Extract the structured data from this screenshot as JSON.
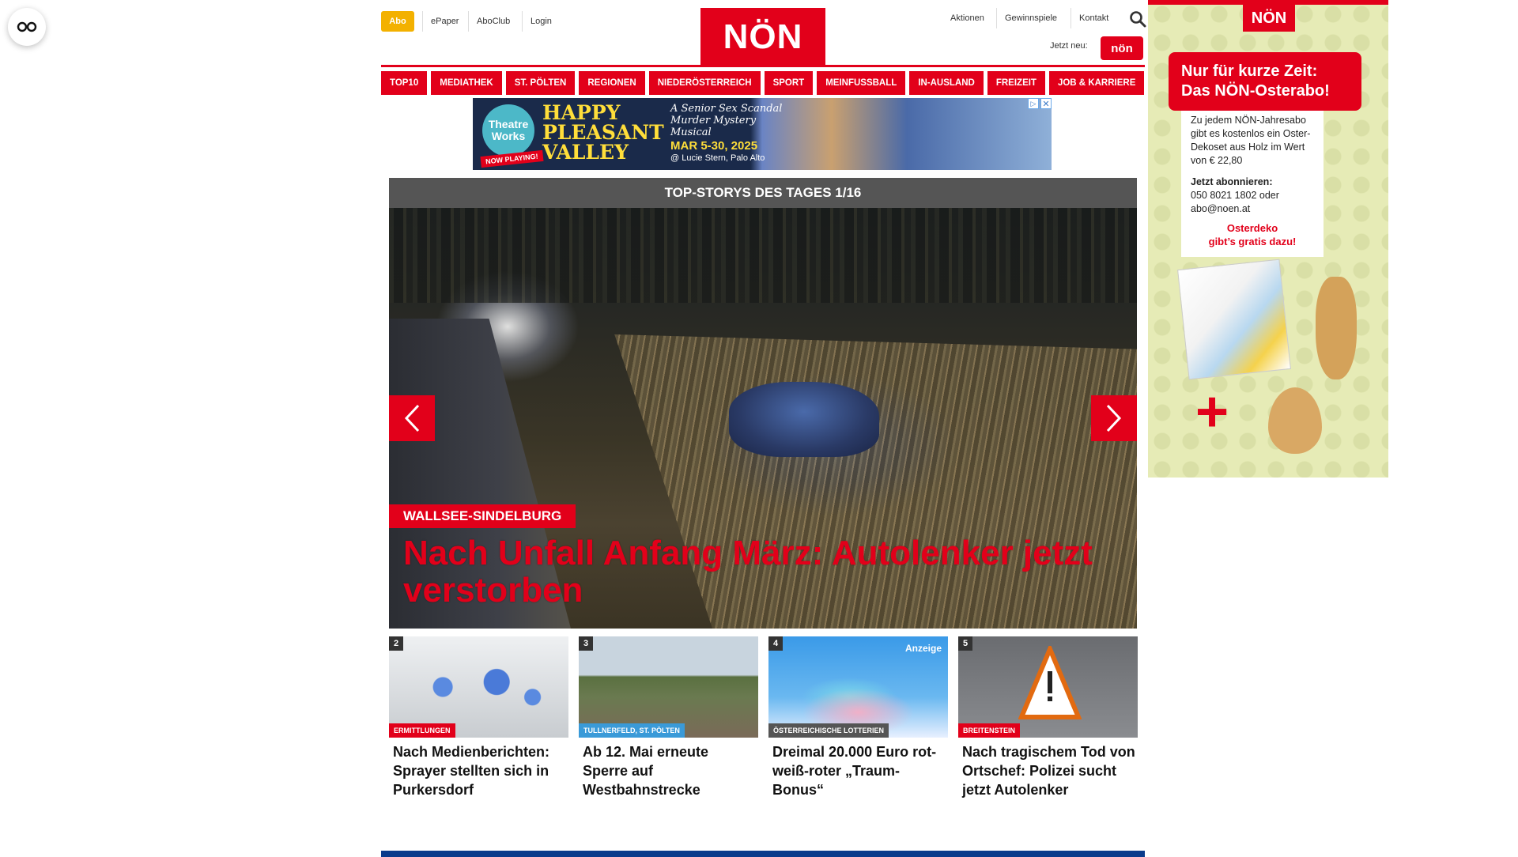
{
  "reader": {
    "icon": "glasses-icon"
  },
  "header": {
    "abo": "Abo",
    "links_left": [
      "ePaper",
      "AboClub",
      "Login"
    ],
    "logo": "NÖN",
    "links_right": [
      "Aktionen",
      "Gewinnspiele",
      "Kontakt"
    ],
    "jetzt_neu": "Jetzt neu:",
    "jetzt_badge": "nön"
  },
  "nav": [
    "TOP10",
    "MEDIATHEK",
    "ST. PÖLTEN",
    "REGIONEN",
    "NIEDERÖSTERREICH",
    "SPORT",
    "MEINFUSSBALL",
    "IN-AUSLAND",
    "FREIZEIT",
    "JOB & KARRIERE"
  ],
  "ad_banner": {
    "logo": "Theatre Works",
    "title_lines": [
      "HAPPY",
      "PLEASANT",
      "VALLEY"
    ],
    "subtitle": "A Senior Sex Scandal Murder Mystery Musical",
    "date": "MAR 5-30, 2025",
    "venue": "@ Lucie Stern, Palo Alto",
    "now_playing": "NOW PLAYING!"
  },
  "stories": {
    "header": "TOP-STORYS DES TAGES 1/16",
    "hero": {
      "category": "WALLSEE-SINDELBURG",
      "title": "Nach Unfall Anfang März: Autolenker jetzt verstorben"
    },
    "cards": [
      {
        "num": "2",
        "category": "ERMITTLUNGEN",
        "title": "Nach Medienberichten: Sprayer stellten sich in Purkersdorf",
        "cat_color": "#e2001a"
      },
      {
        "num": "3",
        "category": "TULLNERFELD, ST. PÖLTEN",
        "title": "Ab 12. Mai erneute Sperre auf Westbahnstrecke",
        "cat_color": "#3a9ad8"
      },
      {
        "num": "4",
        "category": "ÖSTERREICHISCHE LOTTERIEN",
        "title": "Dreimal 20.000 Euro rot-weiß-roter „Traum-Bonus“",
        "cat_color": "#555555",
        "badge": "Anzeige"
      },
      {
        "num": "5",
        "category": "BREITENSTEIN",
        "title": "Nach tragischem Tod von Ortschef: Polizei sucht jetzt Autolenker",
        "cat_color": "#e2001a"
      }
    ]
  },
  "side_ad": {
    "logo": "NÖN",
    "headline_1": "Nur für kurze Zeit:",
    "headline_2": "Das NÖN-Osterabo!",
    "body_1": "Zu jedem NÖN-Jahresabo gibt es kostenlos ein Oster-Dekoset aus Holz im Wert von € 22,80",
    "body_2_title": "Jetzt abonnieren:",
    "body_2": "050 8021 1802 oder abo@noen.at",
    "osterdeko_1": "Osterdeko",
    "osterdeko_2": "gibt’s gratis dazu!",
    "plus": "+"
  },
  "colors": {
    "brand_red": "#e2001a",
    "abo_yellow": "#f3b100",
    "footer_blue": "#0a3c8c"
  }
}
